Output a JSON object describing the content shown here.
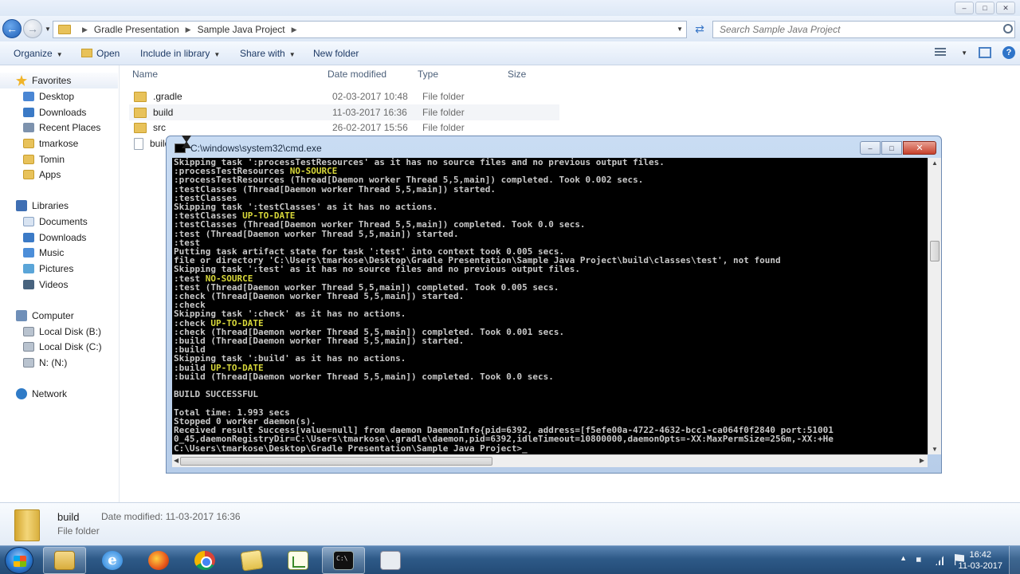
{
  "explorer": {
    "breadcrumb": [
      "Gradle Presentation",
      "Sample Java Project"
    ],
    "search_placeholder": "Search Sample Java Project",
    "toolbar": {
      "organize": "Organize",
      "open": "Open",
      "include_in_library": "Include in library",
      "share_with": "Share with",
      "new_folder": "New folder"
    },
    "columns": {
      "name": "Name",
      "date_modified": "Date modified",
      "type": "Type",
      "size": "Size"
    },
    "files": [
      {
        "name": ".gradle",
        "date": "02-03-2017 10:48",
        "type": "File folder"
      },
      {
        "name": "build",
        "date": "11-03-2017 16:36",
        "type": "File folder"
      },
      {
        "name": "src",
        "date": "26-02-2017 15:56",
        "type": "File folder"
      },
      {
        "name": "build",
        "date": "",
        "type": ""
      }
    ],
    "nav": {
      "favorites": "Favorites",
      "favorites_items": [
        "Desktop",
        "Downloads",
        "Recent Places",
        "tmarkose",
        "Tomin",
        "Apps"
      ],
      "libraries": "Libraries",
      "libraries_items": [
        "Documents",
        "Downloads",
        "Music",
        "Pictures",
        "Videos"
      ],
      "computer": "Computer",
      "computer_items": [
        "Local Disk (B:)",
        "Local Disk (C:)",
        "N: (N:)"
      ],
      "network": "Network"
    },
    "details": {
      "name": "build",
      "type": "File folder",
      "modified_label": "Date modified:",
      "modified_value": "11-03-2017 16:36"
    }
  },
  "cmd": {
    "title": "C:\\windows\\system32\\cmd.exe",
    "lines": [
      {
        "t": "Skipping task ':processTestResources' as it has no source files and no previous output files."
      },
      {
        "t": ":processTestResources ",
        "y": "NO-SOURCE"
      },
      {
        "t": ":processTestResources (Thread[Daemon worker Thread 5,5,main]) completed. Took 0.002 secs."
      },
      {
        "t": ":testClasses (Thread[Daemon worker Thread 5,5,main]) started."
      },
      {
        "t": ":testClasses"
      },
      {
        "t": "Skipping task ':testClasses' as it has no actions."
      },
      {
        "t": ":testClasses ",
        "y": "UP-TO-DATE"
      },
      {
        "t": ":testClasses (Thread[Daemon worker Thread 5,5,main]) completed. Took 0.0 secs."
      },
      {
        "t": ":test (Thread[Daemon worker Thread 5,5,main]) started."
      },
      {
        "t": ":test"
      },
      {
        "t": "Putting task artifact state for task ':test' into context took 0.005 secs."
      },
      {
        "t": "file or directory 'C:\\Users\\tmarkose\\Desktop\\Gradle Presentation\\Sample Java Project\\build\\classes\\test', not found"
      },
      {
        "t": "Skipping task ':test' as it has no source files and no previous output files."
      },
      {
        "t": ":test ",
        "y": "NO-SOURCE"
      },
      {
        "t": ":test (Thread[Daemon worker Thread 5,5,main]) completed. Took 0.005 secs."
      },
      {
        "t": ":check (Thread[Daemon worker Thread 5,5,main]) started."
      },
      {
        "t": ":check"
      },
      {
        "t": "Skipping task ':check' as it has no actions."
      },
      {
        "t": ":check ",
        "y": "UP-TO-DATE"
      },
      {
        "t": ":check (Thread[Daemon worker Thread 5,5,main]) completed. Took 0.001 secs."
      },
      {
        "t": ":build (Thread[Daemon worker Thread 5,5,main]) started."
      },
      {
        "t": ":build"
      },
      {
        "t": "Skipping task ':build' as it has no actions."
      },
      {
        "t": ":build ",
        "y": "UP-TO-DATE"
      },
      {
        "t": ":build (Thread[Daemon worker Thread 5,5,main]) completed. Took 0.0 secs."
      },
      {
        "t": ""
      },
      {
        "t": "BUILD SUCCESSFUL"
      },
      {
        "t": ""
      },
      {
        "t": "Total time: 1.993 secs"
      },
      {
        "t": "Stopped 0 worker daemon(s)."
      },
      {
        "t": "Received result Success[value=null] from daemon DaemonInfo{pid=6392, address=[f5efe00a-4722-4632-bcc1-ca064f0f2840 port:51001"
      },
      {
        "t": "0_45,daemonRegistryDir=C:\\Users\\tmarkose\\.gradle\\daemon,pid=6392,idleTimeout=10800000,daemonOpts=-XX:MaxPermSize=256m,-XX:+He"
      },
      {
        "t": "C:\\Users\\tmarkose\\Desktop\\Gradle Presentation\\Sample Java Project>_"
      }
    ]
  },
  "taskbar": {
    "clock_time": "16:42",
    "clock_date": "11-03-2017"
  }
}
